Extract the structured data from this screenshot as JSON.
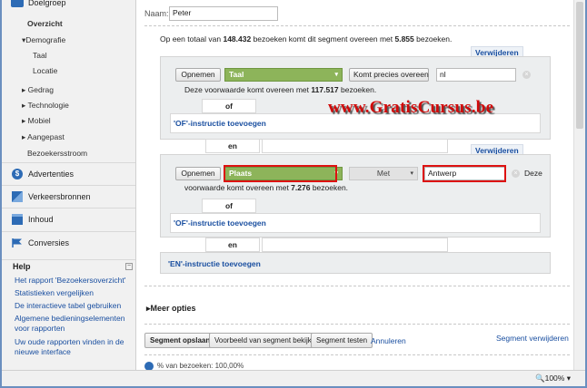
{
  "sidebar": {
    "audience": "Doelgroep",
    "items": {
      "overview": "Overzicht",
      "demography": "Demografie",
      "language": "Taal",
      "location": "Locatie",
      "behavior": "Gedrag",
      "technology": "Technologie",
      "mobile": "Mobiel",
      "custom": "Aangepast",
      "visitor_flow": "Bezoekersstroom"
    },
    "sections": {
      "ads": "Advertenties",
      "traffic": "Verkeersbronnen",
      "content": "Inhoud",
      "conversions": "Conversies"
    },
    "help": {
      "title": "Help",
      "links": [
        "Het rapport 'Bezoekersoverzicht'",
        "Statistieken vergelijken",
        "De interactieve tabel gebruiken",
        "Algemene bedieningselementen voor rapporten",
        "Uw oude rapporten vinden in de nieuwe interface"
      ]
    }
  },
  "form": {
    "name_label": "Naam:",
    "name_value": "Peter",
    "summary_prefix": "Op een totaal van ",
    "summary_total": "148.432",
    "summary_mid": " bezoeken komt dit segment overeen met ",
    "summary_match": "5.855",
    "summary_suffix": " bezoeken.",
    "delete_label": "Verwijderen",
    "include_label": "Opnemen",
    "or_text": "of",
    "and_text": "en",
    "or_link": "'OF'-instructie toevoegen",
    "and_link": "'EN'-instructie toevoegen"
  },
  "condition1": {
    "dimension": "Taal",
    "operator": "Komt precies overeen",
    "value": "nl",
    "text_prefix": "Deze voorwaarde komt overeen met ",
    "count": "117.517",
    "text_suffix": " bezoeken."
  },
  "condition2": {
    "dimension": "Plaats",
    "operator": "Met",
    "value": "Antwerp",
    "text_prefix_a": "Deze",
    "text_prefix_b": "voorwaarde komt overeen met ",
    "count": "7.276",
    "text_suffix": " bezoeken."
  },
  "watermark": "www.GratisCursus.be",
  "more_options": "Meer opties",
  "actions": {
    "save": "Segment opslaan",
    "preview": "Voorbeeld van segment bekijken",
    "test": "Segment testen",
    "cancel": "Annuleren",
    "delete_segment": "Segment verwijderen"
  },
  "pct_label": "% van bezoeken: 100,00%",
  "statusbar": {
    "zoom": "100%"
  },
  "colors": {
    "accent_green": "#8db45a",
    "link_blue": "#1a4fa0",
    "highlight_red": "#d11111"
  }
}
